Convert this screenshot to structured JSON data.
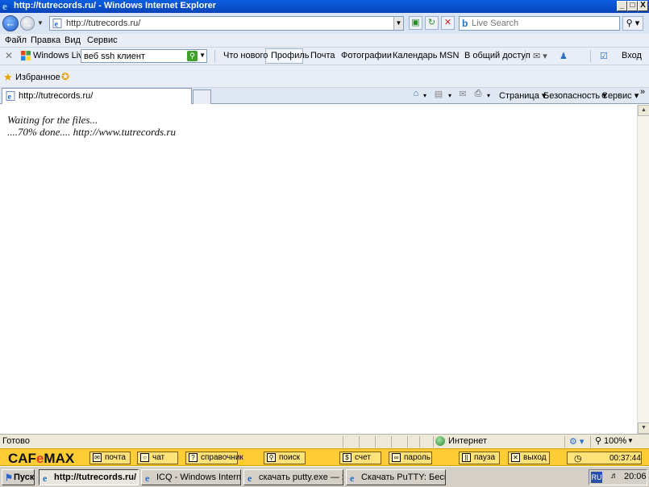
{
  "window": {
    "title": "http://tutrecords.ru/ - Windows Internet Explorer",
    "buttons": {
      "minimize": "_",
      "maximize": "□",
      "close": "X"
    }
  },
  "address_bar": {
    "url": "http://tutrecords.ru/",
    "search_placeholder": "Live Search"
  },
  "menu": [
    "Файл",
    "Правка",
    "Вид",
    "Сервис"
  ],
  "live_toolbar": {
    "brand": "Windows Live",
    "search_value": "веб ssh клиент",
    "links": [
      "Что нового",
      "Профиль",
      "Почта",
      "Фотографии",
      "Календарь",
      "MSN",
      "В общий доступ"
    ],
    "signin": "Вход"
  },
  "favorites": {
    "label": "Избранное"
  },
  "tab": {
    "label": "http://tutrecords.ru/"
  },
  "command_bar": {
    "page": "Страница",
    "safety": "Безопасность",
    "tools": "Сервис"
  },
  "content": {
    "line1": "Waiting for the files...",
    "line2": "....70% done.... http://www.tutrecords.ru"
  },
  "status_bar": {
    "status": "Готово",
    "zone": "Интернет",
    "zoom": "100%"
  },
  "cafemax": {
    "logo_pre": "CAF",
    "logo_o": "e",
    "logo_post": "MAX",
    "buttons": [
      "почта",
      "чат",
      "справочник",
      "поиск",
      "счет",
      "пароль",
      "пауза",
      "выход"
    ],
    "timer": "00:37:44"
  },
  "taskbar": {
    "start": "Пуск",
    "windows": [
      "http://tutrecords.ru/ ...",
      "ICQ - Windows Internet ...",
      "скачать putty.exe — Я...",
      "Скачать PuTTY: Беспла..."
    ],
    "lang": "RU",
    "clock": "20:06"
  },
  "colors": {
    "titlebar": "#0a5ee0",
    "cafemax_bar": "#ffcc33",
    "cafemax_logo_accent": "#e03a2e"
  }
}
